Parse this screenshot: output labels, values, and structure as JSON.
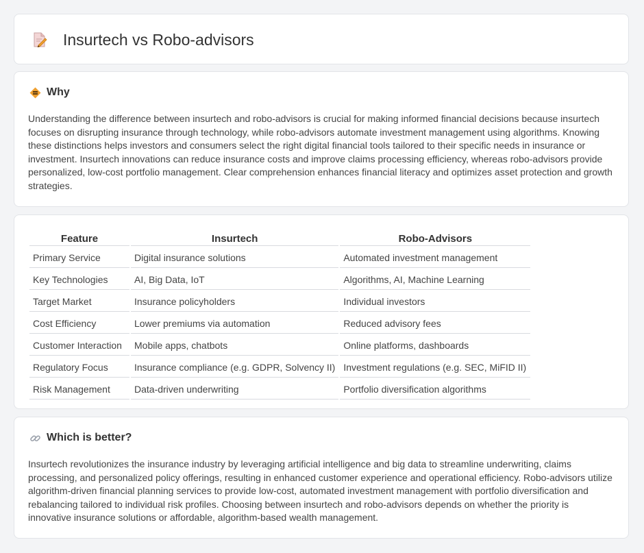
{
  "header": {
    "title": "Insurtech vs Robo-advisors",
    "icon": "document-pencil-icon"
  },
  "why": {
    "icon": "diamond-warning-icon",
    "title": "Why",
    "body": "Understanding the difference between insurtech and robo-advisors is crucial for making informed financial decisions because insurtech focuses on disrupting insurance through technology, while robo-advisors automate investment management using algorithms. Knowing these distinctions helps investors and consumers select the right digital financial tools tailored to their specific needs in insurance or investment. Insurtech innovations can reduce insurance costs and improve claims processing efficiency, whereas robo-advisors provide personalized, low-cost portfolio management. Clear comprehension enhances financial literacy and optimizes asset protection and growth strategies."
  },
  "table": {
    "headers": [
      "Feature",
      "Insurtech",
      "Robo-Advisors"
    ],
    "rows": [
      [
        "Primary Service",
        "Digital insurance solutions",
        "Automated investment management"
      ],
      [
        "Key Technologies",
        "AI, Big Data, IoT",
        "Algorithms, AI, Machine Learning"
      ],
      [
        "Target Market",
        "Insurance policyholders",
        "Individual investors"
      ],
      [
        "Cost Efficiency",
        "Lower premiums via automation",
        "Reduced advisory fees"
      ],
      [
        "Customer Interaction",
        "Mobile apps, chatbots",
        "Online platforms, dashboards"
      ],
      [
        "Regulatory Focus",
        "Insurance compliance (e.g. GDPR, Solvency II)",
        "Investment regulations (e.g. SEC, MiFID II)"
      ],
      [
        "Risk Management",
        "Data-driven underwriting",
        "Portfolio diversification algorithms"
      ]
    ]
  },
  "better": {
    "icon": "link-icon",
    "title": "Which is better?",
    "body": "Insurtech revolutionizes the insurance industry by leveraging artificial intelligence and big data to streamline underwriting, claims processing, and personalized policy offerings, resulting in enhanced customer experience and operational efficiency. Robo-advisors utilize algorithm-driven financial planning services to provide low-cost, automated investment management with portfolio diversification and rebalancing tailored to individual risk profiles. Choosing between insurtech and robo-advisors depends on whether the priority is innovative insurance solutions or affordable, algorithm-based wealth management."
  },
  "colors": {
    "background": "#f3f4f6",
    "card": "#ffffff",
    "border": "#e2e4e8",
    "accent_orange": "#f0a030",
    "icon_pink": "#e07a7a"
  }
}
